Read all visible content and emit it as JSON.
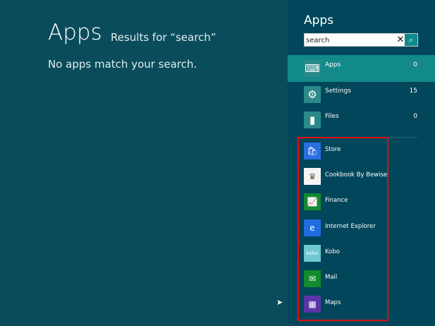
{
  "main": {
    "title": "Apps",
    "results_for": "Results for “search”",
    "message": "No apps match your search."
  },
  "panel": {
    "title": "Apps",
    "search": {
      "value": "search",
      "clear_icon": "close-icon",
      "go_icon": "search-icon"
    },
    "categories": [
      {
        "label": "Apps",
        "count": "0",
        "icon": "keyboard-icon"
      },
      {
        "label": "Settings",
        "count": "15",
        "icon": "gear-icon"
      },
      {
        "label": "Files",
        "count": "0",
        "icon": "file-icon"
      }
    ],
    "apps": [
      {
        "label": "Store",
        "color": "#2a6fe0",
        "glyph": "🛍"
      },
      {
        "label": "Cookbook By Bewise",
        "color": "#f4f4f4",
        "glyph": "♛"
      },
      {
        "label": "Finance",
        "color": "#138a30",
        "glyph": "📈"
      },
      {
        "label": "Internet Explorer",
        "color": "#1f6de0",
        "glyph": "e"
      },
      {
        "label": "Kobo",
        "color": "#6fc7d0",
        "glyph": "kobo"
      },
      {
        "label": "Mail",
        "color": "#128a2e",
        "glyph": "✉"
      },
      {
        "label": "Maps",
        "color": "#5b35a8",
        "glyph": "▦"
      }
    ]
  }
}
